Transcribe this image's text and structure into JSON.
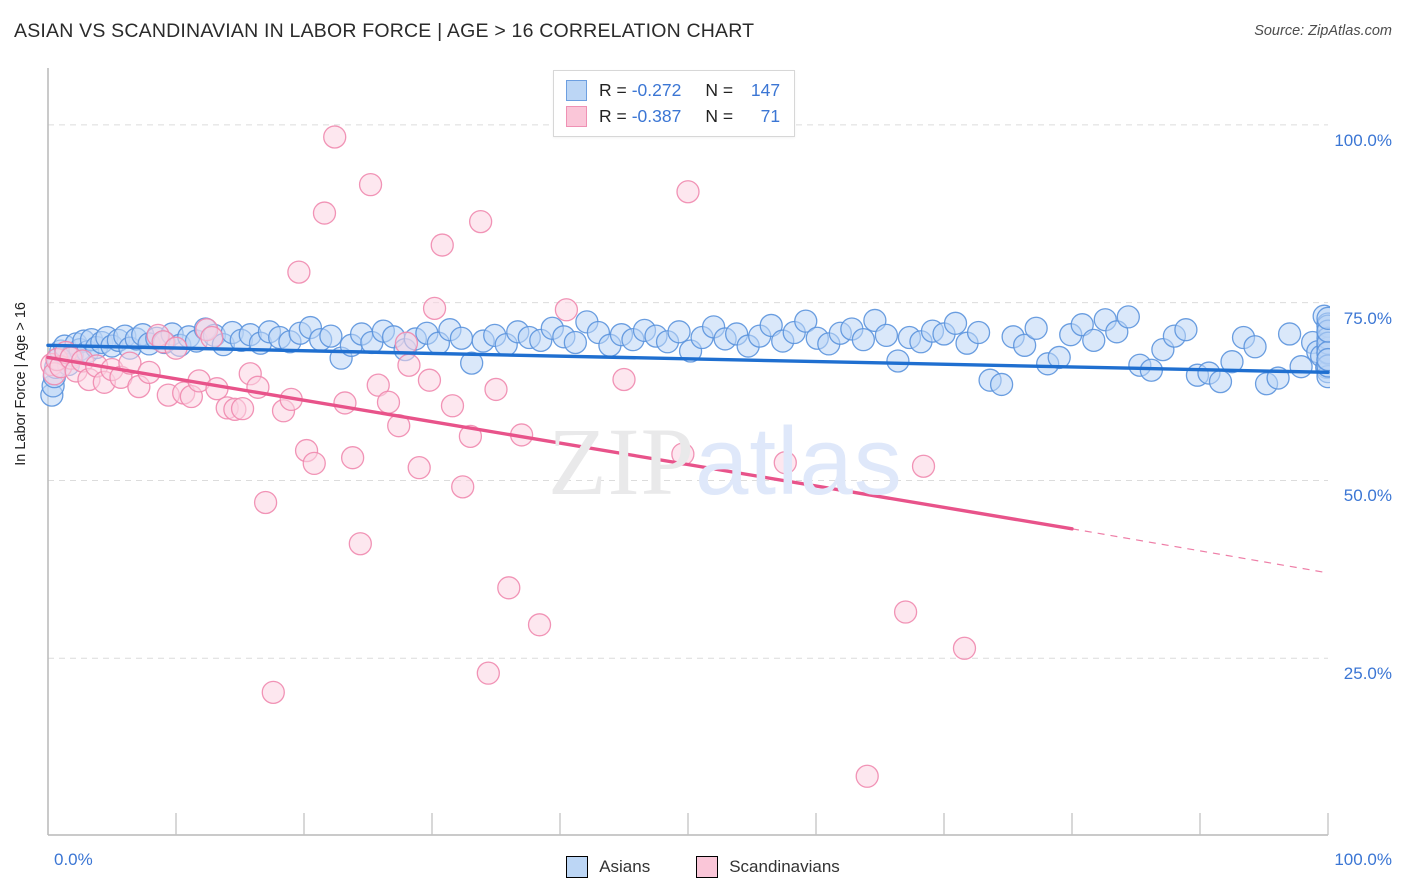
{
  "header": {
    "title": "ASIAN VS SCANDINAVIAN IN LABOR FORCE | AGE > 16 CORRELATION CHART",
    "source": "Source: ZipAtlas.com"
  },
  "watermark": {
    "part1": "ZIP",
    "part2": "atlas"
  },
  "stats": {
    "rows": [
      {
        "series": "Asians",
        "r_label": "R =",
        "r_value": "-0.272",
        "n_label": "N =",
        "n_value": "147",
        "color": "#bcd6f5",
        "stroke": "#6d9fe0"
      },
      {
        "series": "Scandinavians",
        "r_label": "R =",
        "r_value": "-0.387",
        "n_label": "N =",
        "n_value": "71",
        "color": "#fac6d8",
        "stroke": "#ef91b4"
      }
    ]
  },
  "legend": {
    "items": [
      {
        "label": "Asians",
        "color": "#bcd6f5",
        "stroke": "#6d9fe0"
      },
      {
        "label": "Scandinavians",
        "color": "#fac6d8",
        "stroke": "#ef91b4"
      }
    ]
  },
  "axes": {
    "y_title": "In Labor Force | Age > 16",
    "y_ticks": [
      "100.0%",
      "75.0%",
      "50.0%",
      "25.0%"
    ],
    "x_ticks": [
      "0.0%",
      "100.0%"
    ]
  },
  "chart_data": {
    "type": "scatter",
    "title": "ASIAN VS SCANDINAVIAN IN LABOR FORCE | AGE > 16 CORRELATION CHART",
    "xlabel": "",
    "ylabel": "In Labor Force | Age > 16",
    "xlim": [
      0,
      100
    ],
    "ylim": [
      0,
      108
    ],
    "x_ticks": [
      0,
      100
    ],
    "y_ticks": [
      25,
      50,
      75,
      100
    ],
    "grid": "horizontal-dashed",
    "legend_position": "bottom-center",
    "series": [
      {
        "name": "Asians",
        "color": "#bcd6f5",
        "stroke": "#5b93dd",
        "r": -0.272,
        "n": 147,
        "trend": {
          "x0": 0,
          "y0": 69.0,
          "x1": 100,
          "y1": 65.2,
          "color": "#1f6fd0"
        },
        "points": [
          [
            0.3,
            62.0
          ],
          [
            0.4,
            63.3
          ],
          [
            0.5,
            64.6
          ],
          [
            0.6,
            65.9
          ],
          [
            0.8,
            67.1
          ],
          [
            1.0,
            68.2
          ],
          [
            1.3,
            68.9
          ],
          [
            1.6,
            66.3
          ],
          [
            1.9,
            67.6
          ],
          [
            2.2,
            69.2
          ],
          [
            2.5,
            68.4
          ],
          [
            2.8,
            69.6
          ],
          [
            3.1,
            68.1
          ],
          [
            3.4,
            69.8
          ],
          [
            3.8,
            68.7
          ],
          [
            4.2,
            69.4
          ],
          [
            4.6,
            70.1
          ],
          [
            5.0,
            68.9
          ],
          [
            5.5,
            69.7
          ],
          [
            6.0,
            70.3
          ],
          [
            6.4,
            68.6
          ],
          [
            6.9,
            69.9
          ],
          [
            7.4,
            70.5
          ],
          [
            7.9,
            69.2
          ],
          [
            8.5,
            70.0
          ],
          [
            9.1,
            69.4
          ],
          [
            9.7,
            70.6
          ],
          [
            10.3,
            69.0
          ],
          [
            11.0,
            70.2
          ],
          [
            11.6,
            69.6
          ],
          [
            12.3,
            71.3
          ],
          [
            13.0,
            70.4
          ],
          [
            13.7,
            69.1
          ],
          [
            14.4,
            70.8
          ],
          [
            15.1,
            69.7
          ],
          [
            15.8,
            70.5
          ],
          [
            16.6,
            69.3
          ],
          [
            17.3,
            70.9
          ],
          [
            18.1,
            70.1
          ],
          [
            18.9,
            69.5
          ],
          [
            19.7,
            70.7
          ],
          [
            20.5,
            71.5
          ],
          [
            21.3,
            69.8
          ],
          [
            22.1,
            70.3
          ],
          [
            22.9,
            67.2
          ],
          [
            23.7,
            69.0
          ],
          [
            24.5,
            70.6
          ],
          [
            25.3,
            69.4
          ],
          [
            26.2,
            71.0
          ],
          [
            27.0,
            70.2
          ],
          [
            27.9,
            68.4
          ],
          [
            28.7,
            69.9
          ],
          [
            29.6,
            70.7
          ],
          [
            30.5,
            69.3
          ],
          [
            31.4,
            71.2
          ],
          [
            32.3,
            70.0
          ],
          [
            33.1,
            66.5
          ],
          [
            34.0,
            69.6
          ],
          [
            34.9,
            70.4
          ],
          [
            35.8,
            69.1
          ],
          [
            36.7,
            70.9
          ],
          [
            37.6,
            70.1
          ],
          [
            38.5,
            69.7
          ],
          [
            39.4,
            71.4
          ],
          [
            40.3,
            70.2
          ],
          [
            41.2,
            69.4
          ],
          [
            42.1,
            72.3
          ],
          [
            43.0,
            70.8
          ],
          [
            43.9,
            69.0
          ],
          [
            44.8,
            70.5
          ],
          [
            45.7,
            69.8
          ],
          [
            46.6,
            71.1
          ],
          [
            47.5,
            70.3
          ],
          [
            48.4,
            69.5
          ],
          [
            49.3,
            70.9
          ],
          [
            50.2,
            68.2
          ],
          [
            51.1,
            70.1
          ],
          [
            52.0,
            71.6
          ],
          [
            52.9,
            69.9
          ],
          [
            53.8,
            70.6
          ],
          [
            54.7,
            68.9
          ],
          [
            55.6,
            70.3
          ],
          [
            56.5,
            71.8
          ],
          [
            57.4,
            69.6
          ],
          [
            58.3,
            70.8
          ],
          [
            59.2,
            72.4
          ],
          [
            60.1,
            70.0
          ],
          [
            61.0,
            69.2
          ],
          [
            61.9,
            70.7
          ],
          [
            62.8,
            71.3
          ],
          [
            63.7,
            69.8
          ],
          [
            64.6,
            72.5
          ],
          [
            65.5,
            70.4
          ],
          [
            66.4,
            66.8
          ],
          [
            67.3,
            70.1
          ],
          [
            68.2,
            69.5
          ],
          [
            69.1,
            71.0
          ],
          [
            70.0,
            70.6
          ],
          [
            70.9,
            72.1
          ],
          [
            71.8,
            69.3
          ],
          [
            72.7,
            70.8
          ],
          [
            73.6,
            64.1
          ],
          [
            74.5,
            63.5
          ],
          [
            75.4,
            70.2
          ],
          [
            76.3,
            69.0
          ],
          [
            77.2,
            71.4
          ],
          [
            78.1,
            66.4
          ],
          [
            79.0,
            67.3
          ],
          [
            79.9,
            70.5
          ],
          [
            80.8,
            71.9
          ],
          [
            81.7,
            69.7
          ],
          [
            82.6,
            72.6
          ],
          [
            83.5,
            70.9
          ],
          [
            84.4,
            73.0
          ],
          [
            85.3,
            66.2
          ],
          [
            86.2,
            65.5
          ],
          [
            87.1,
            68.4
          ],
          [
            88.0,
            70.3
          ],
          [
            88.9,
            71.2
          ],
          [
            89.8,
            64.8
          ],
          [
            90.7,
            65.1
          ],
          [
            91.6,
            63.9
          ],
          [
            92.5,
            66.7
          ],
          [
            93.4,
            70.1
          ],
          [
            94.3,
            68.8
          ],
          [
            95.2,
            63.6
          ],
          [
            96.1,
            64.4
          ],
          [
            97.0,
            70.6
          ],
          [
            97.9,
            66.0
          ],
          [
            98.8,
            69.4
          ],
          [
            99.2,
            68.1
          ],
          [
            99.5,
            67.5
          ],
          [
            99.7,
            73.1
          ],
          [
            99.9,
            65.9
          ],
          [
            100.0,
            65.3
          ],
          [
            100.0,
            69.1
          ],
          [
            100.0,
            70.8
          ],
          [
            100.0,
            72.0
          ],
          [
            100.0,
            66.9
          ],
          [
            100.0,
            68.6
          ],
          [
            100.0,
            71.7
          ],
          [
            100.0,
            67.9
          ],
          [
            100.0,
            64.6
          ],
          [
            100.0,
            70.0
          ],
          [
            100.0,
            69.3
          ],
          [
            100.0,
            68.0
          ],
          [
            100.0,
            71.0
          ],
          [
            100.0,
            66.1
          ],
          [
            100.0,
            67.0
          ],
          [
            100.0,
            72.8
          ]
        ]
      },
      {
        "name": "Scandinavians",
        "color": "#fbd4e1",
        "stroke": "#ef88ae",
        "r": -0.387,
        "n": 71,
        "trend": {
          "x0": 0,
          "y0": 67.3,
          "x1": 80,
          "y1": 43.2,
          "color": "#e8538a",
          "dash_from": 80,
          "dash_to": 100,
          "dash_y1": 37.0
        },
        "points": [
          [
            0.3,
            66.3
          ],
          [
            0.5,
            65.0
          ],
          [
            0.7,
            67.0
          ],
          [
            1.0,
            66.0
          ],
          [
            1.4,
            68.0
          ],
          [
            1.8,
            67.2
          ],
          [
            2.2,
            65.4
          ],
          [
            2.7,
            66.8
          ],
          [
            3.2,
            64.2
          ],
          [
            3.8,
            66.1
          ],
          [
            4.4,
            63.8
          ],
          [
            5.0,
            65.6
          ],
          [
            5.7,
            64.5
          ],
          [
            6.4,
            66.5
          ],
          [
            7.1,
            63.2
          ],
          [
            7.9,
            65.2
          ],
          [
            8.6,
            70.4
          ],
          [
            9.0,
            69.5
          ],
          [
            9.4,
            62.0
          ],
          [
            10.0,
            68.6
          ],
          [
            10.6,
            62.3
          ],
          [
            11.2,
            61.8
          ],
          [
            11.8,
            64.0
          ],
          [
            12.4,
            71.2
          ],
          [
            12.8,
            70.1
          ],
          [
            13.2,
            62.9
          ],
          [
            14.0,
            60.2
          ],
          [
            14.6,
            60.0
          ],
          [
            15.2,
            60.1
          ],
          [
            15.8,
            65.0
          ],
          [
            16.4,
            63.1
          ],
          [
            17.0,
            46.9
          ],
          [
            17.6,
            20.2
          ],
          [
            18.4,
            59.8
          ],
          [
            19.0,
            61.4
          ],
          [
            19.6,
            79.3
          ],
          [
            20.2,
            54.2
          ],
          [
            20.8,
            52.4
          ],
          [
            21.6,
            87.6
          ],
          [
            22.4,
            98.3
          ],
          [
            23.2,
            60.9
          ],
          [
            23.8,
            53.2
          ],
          [
            24.4,
            41.1
          ],
          [
            25.2,
            91.6
          ],
          [
            25.8,
            63.4
          ],
          [
            26.6,
            61.0
          ],
          [
            27.4,
            57.7
          ],
          [
            28.0,
            69.3
          ],
          [
            28.2,
            66.2
          ],
          [
            29.0,
            51.8
          ],
          [
            29.8,
            64.1
          ],
          [
            30.2,
            74.2
          ],
          [
            30.8,
            83.1
          ],
          [
            31.6,
            60.5
          ],
          [
            32.4,
            49.1
          ],
          [
            33.0,
            56.2
          ],
          [
            33.8,
            86.4
          ],
          [
            34.4,
            22.9
          ],
          [
            35.0,
            62.8
          ],
          [
            36.0,
            34.9
          ],
          [
            37.0,
            56.4
          ],
          [
            38.4,
            29.7
          ],
          [
            40.5,
            74.0
          ],
          [
            45.0,
            64.2
          ],
          [
            49.6,
            53.7
          ],
          [
            50.0,
            90.6
          ],
          [
            57.6,
            52.5
          ],
          [
            64.0,
            8.4
          ],
          [
            67.0,
            31.5
          ],
          [
            68.4,
            52.0
          ],
          [
            71.6,
            26.4
          ]
        ]
      }
    ]
  }
}
